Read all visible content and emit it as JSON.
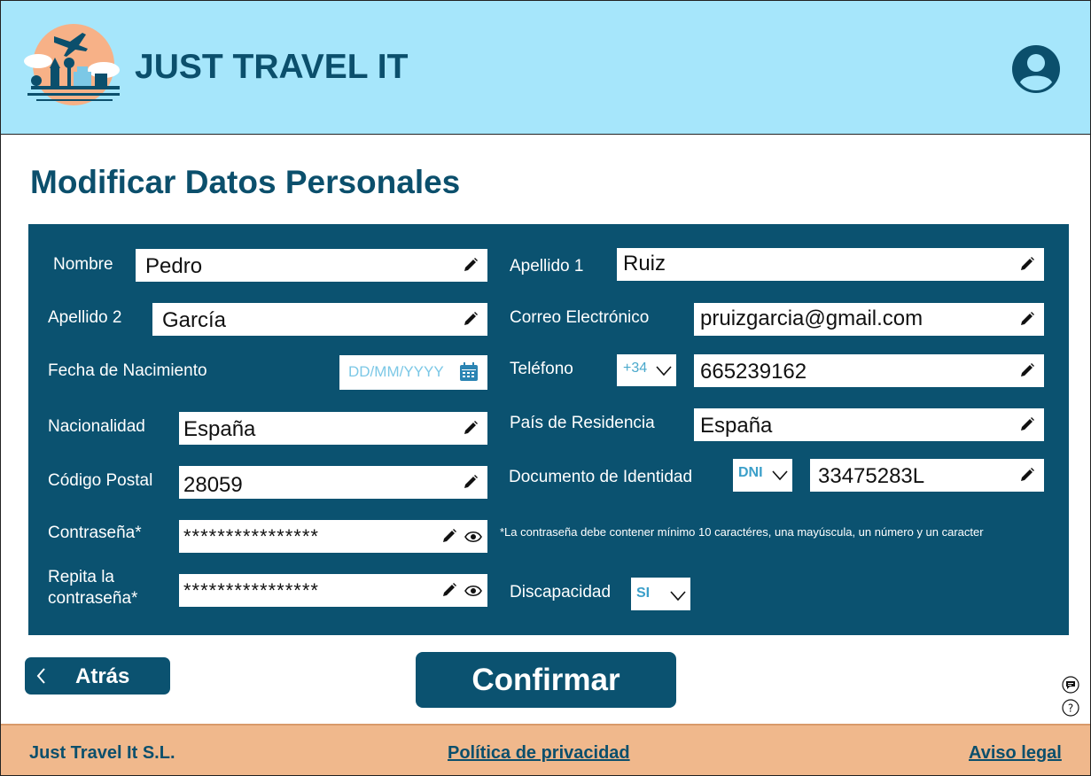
{
  "header": {
    "brand": "JUST TRAVEL IT",
    "logo_icon": "travel-city-sun-plane-logo",
    "account_icon": "user-account-icon"
  },
  "page": {
    "title": "Modificar Datos Personales"
  },
  "form": {
    "nombre": {
      "label": "Nombre",
      "value": "Pedro"
    },
    "apellido1": {
      "label": "Apellido 1",
      "value": "Ruiz"
    },
    "apellido2": {
      "label": "Apellido 2",
      "value": "García"
    },
    "correo": {
      "label": "Correo Electrónico",
      "value": "pruizgarcia@gmail.com"
    },
    "fecha_nacimiento": {
      "label": "Fecha de Nacimiento",
      "placeholder": "DD/MM/YYYY"
    },
    "telefono": {
      "label": "Teléfono",
      "prefix": "+34",
      "value": "665239162"
    },
    "nacionalidad": {
      "label": "Nacionalidad",
      "value": "España"
    },
    "pais_residencia": {
      "label": "País de Residencia",
      "value": "España"
    },
    "codigo_postal": {
      "label": "Código Postal",
      "value": "28059"
    },
    "documento": {
      "label": "Documento de Identidad",
      "type": "DNI",
      "value": "33475283L"
    },
    "contrasena": {
      "label": "Contraseña*",
      "value": "****************"
    },
    "repita_contrasena": {
      "label_line1": "Repita la",
      "label_line2": "contraseña*",
      "value": "****************"
    },
    "discapacidad": {
      "label": "Discapacidad",
      "value": "SI"
    },
    "password_hint": "*La contraseña debe contener mínimo 10 caractéres, una mayúscula, un número y un caracter"
  },
  "actions": {
    "back_label": "Atrás",
    "confirm_label": "Confirmar"
  },
  "footer": {
    "company": "Just Travel It S.L.",
    "privacy": "Política de privacidad",
    "legal": "Aviso legal"
  },
  "colors": {
    "header_bg": "#a6e6fb",
    "brand": "#0b4f6c",
    "panel_bg": "#0b5270",
    "footer_bg": "#f0b88c"
  }
}
